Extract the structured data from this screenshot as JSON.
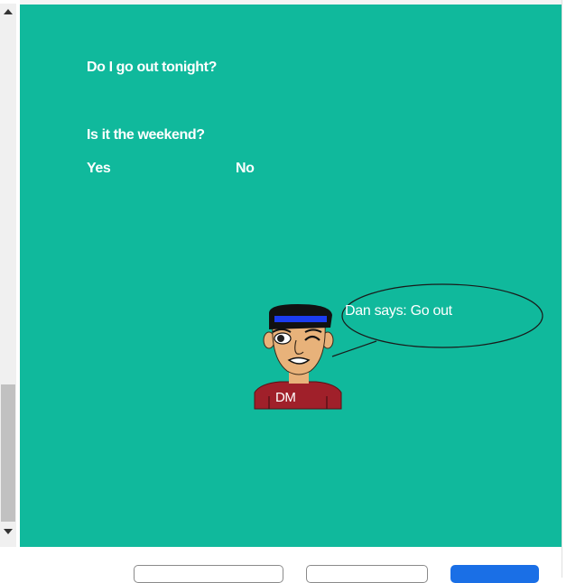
{
  "question_1": "Do I go out tonight?",
  "question_2": "Is it the weekend?",
  "choices": {
    "yes": "Yes",
    "no": "No"
  },
  "speech": "Dan says: Go out",
  "avatar_initials": "DM",
  "colors": {
    "stage": "#10b99c",
    "primary_button": "#1a6fe6"
  }
}
